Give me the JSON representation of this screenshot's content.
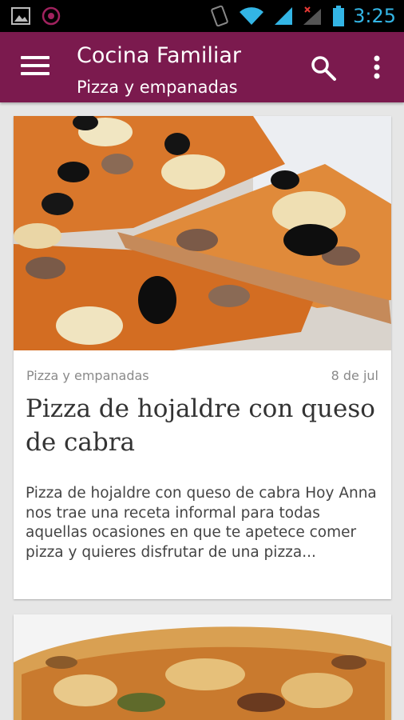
{
  "status_bar": {
    "time": "3:25",
    "icons": [
      "image-icon",
      "app-icon",
      "vibrate-icon",
      "wifi-icon",
      "signal-icon",
      "no-signal-icon",
      "battery-icon"
    ]
  },
  "app_bar": {
    "title": "Cocina Familiar",
    "subtitle": "Pizza y empanadas",
    "background": "#7b1a4e",
    "icons": [
      "menu-icon",
      "search-icon",
      "more-vert-icon"
    ]
  },
  "posts": [
    {
      "category": "Pizza y empanadas",
      "date": "8 de jul",
      "title": "Pizza de hojaldre con queso de cabra",
      "excerpt": "Pizza de hojaldre con queso de cabra Hoy Anna nos trae una receta informal para todas aquellas ocasiones en que te apetece comer pizza y quieres disfrutar de una pizza..."
    }
  ]
}
